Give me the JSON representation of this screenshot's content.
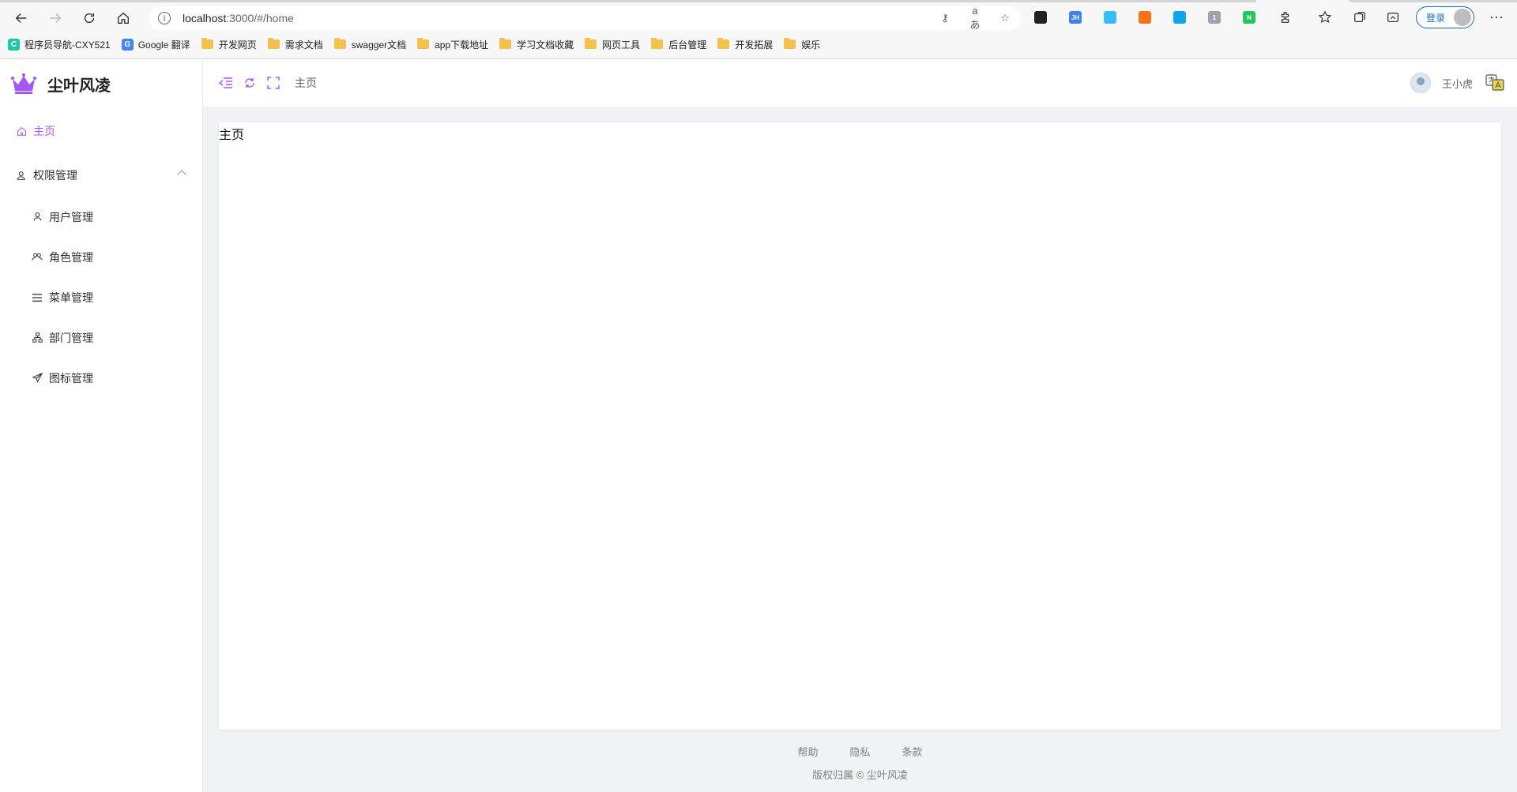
{
  "browser": {
    "url_host": "localhost",
    "url_rest": ":3000/#/home",
    "login_label": "登录",
    "more_label": "···",
    "bookmarks": [
      {
        "label": "程序员导航-CXY521",
        "icon": "cxy-favicon",
        "color": "#1ec7a5",
        "glyph": "C"
      },
      {
        "label": "Google 翻译",
        "icon": "google-translate-favicon",
        "color": "#4285f4",
        "glyph": "G"
      },
      {
        "label": "开发网页",
        "icon": "folder-icon"
      },
      {
        "label": "需求文档",
        "icon": "folder-icon"
      },
      {
        "label": "swagger文档",
        "icon": "folder-icon"
      },
      {
        "label": "app下载地址",
        "icon": "folder-icon"
      },
      {
        "label": "学习文档收藏",
        "icon": "folder-icon"
      },
      {
        "label": "网页工具",
        "icon": "folder-icon"
      },
      {
        "label": "后台管理",
        "icon": "folder-icon"
      },
      {
        "label": "开发拓展",
        "icon": "folder-icon"
      },
      {
        "label": "娱乐",
        "icon": "folder-icon"
      }
    ],
    "extensions": [
      {
        "name": "ext-dark-icon",
        "color": "#222222",
        "glyph": ""
      },
      {
        "name": "ext-jh-icon",
        "color": "#3b82f6",
        "glyph": "JH"
      },
      {
        "name": "ext-blue-feather-icon",
        "color": "#38bdf8",
        "glyph": ""
      },
      {
        "name": "ext-orange-tree-icon",
        "color": "#f97316",
        "glyph": ""
      },
      {
        "name": "ext-telegram-icon",
        "color": "#0ea5e9",
        "glyph": ""
      },
      {
        "name": "ext-gray-badge-icon",
        "color": "#9ca3af",
        "glyph": "1"
      },
      {
        "name": "ext-green-n-icon",
        "color": "#22c55e",
        "glyph": "N"
      }
    ]
  },
  "app": {
    "brand": "尘叶风凌",
    "accent": "#a855f7",
    "menu": {
      "home": "主页",
      "permission": "权限管理",
      "sub": [
        {
          "label": "用户管理",
          "icon": "user-icon"
        },
        {
          "label": "角色管理",
          "icon": "users-icon"
        },
        {
          "label": "菜单管理",
          "icon": "menu-lines-icon"
        },
        {
          "label": "部门管理",
          "icon": "org-chart-icon"
        },
        {
          "label": "图标管理",
          "icon": "paper-plane-icon"
        }
      ]
    },
    "header": {
      "breadcrumb": "主页",
      "username": "王小虎"
    },
    "page_title": "主页",
    "footer": {
      "links": [
        "帮助",
        "隐私",
        "条款"
      ],
      "copyright": "版权归属 © 尘叶风凌"
    }
  }
}
